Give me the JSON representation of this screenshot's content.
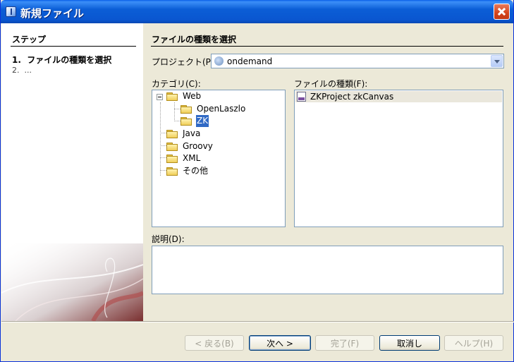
{
  "window": {
    "title": "新規ファイル"
  },
  "steps": {
    "heading": "ステップ",
    "items": [
      {
        "number": "1.",
        "label": "ファイルの種類を選択"
      },
      {
        "number": "2.",
        "label": "..."
      }
    ]
  },
  "main": {
    "heading": "ファイルの種類を選択",
    "project_label": "プロジェクト(P):",
    "project_value": "ondemand",
    "categories_label": "カテゴリ(C):",
    "file_types_label": "ファイルの種類(F):",
    "description_label": "説明(D):",
    "categories": [
      {
        "label": "Web"
      },
      {
        "label": "OpenLaszlo"
      },
      {
        "label": "ZK"
      },
      {
        "label": "Java"
      },
      {
        "label": "Groovy"
      },
      {
        "label": "XML"
      },
      {
        "label": "その他"
      }
    ],
    "file_types": [
      {
        "label": "ZKProject zkCanvas"
      }
    ]
  },
  "buttons": {
    "back": "< 戻る(B)",
    "next": "次へ >",
    "finish": "完了(F)",
    "cancel": "取消し",
    "help": "ヘルプ(H)"
  }
}
